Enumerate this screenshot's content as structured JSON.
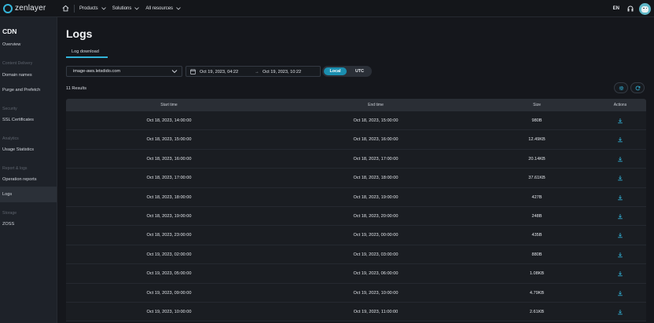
{
  "brand": {
    "name": "zenlayer",
    "accent": "#32b3d9"
  },
  "topnav": {
    "items": [
      {
        "label": "Products"
      },
      {
        "label": "Solutions"
      },
      {
        "label": "All resources"
      }
    ],
    "language": "EN"
  },
  "sidebar": {
    "title": "CDN",
    "overview": "Overview",
    "group_content_delivery": "Content Delivery",
    "domain_names": "Domain names",
    "purge_prefetch": "Purge and Prefetch",
    "group_security": "Security",
    "ssl_certificates": "SSL Certificates",
    "group_analytics": "Analytics",
    "usage_statistics": "Usage Statistics",
    "group_report_logs": "Report & logs",
    "operation_reports": "Operation reports",
    "logs": "Logs",
    "group_storage": "Storage",
    "zoss": "ZOSS"
  },
  "page": {
    "title": "Logs",
    "tab_label": "Log download"
  },
  "filters": {
    "domain": "image-aws.letsdido.com",
    "start_date": "Oct 19, 2023, 04:22",
    "end_date": "Oct 19, 2023, 10:22",
    "arrow": "→",
    "tz_local": "Local",
    "tz_utc": "UTC"
  },
  "results_label": "11 Results",
  "table": {
    "headers": {
      "start": "Start time",
      "end": "End time",
      "size": "Size",
      "actions": "Actions"
    },
    "rows": [
      {
        "start": "Oct 18, 2023, 14:00:00",
        "end": "Oct 18, 2023, 15:00:00",
        "size": "980B"
      },
      {
        "start": "Oct 18, 2023, 15:00:00",
        "end": "Oct 18, 2023, 16:00:00",
        "size": "12.49KB"
      },
      {
        "start": "Oct 18, 2023, 16:00:00",
        "end": "Oct 18, 2023, 17:00:00",
        "size": "20.14KB"
      },
      {
        "start": "Oct 18, 2023, 17:00:00",
        "end": "Oct 18, 2023, 18:00:00",
        "size": "37.61KB"
      },
      {
        "start": "Oct 18, 2023, 18:00:00",
        "end": "Oct 18, 2023, 19:00:00",
        "size": "427B"
      },
      {
        "start": "Oct 18, 2023, 19:00:00",
        "end": "Oct 18, 2023, 20:00:00",
        "size": "248B"
      },
      {
        "start": "Oct 18, 2023, 23:00:00",
        "end": "Oct 19, 2023, 00:00:00",
        "size": "435B"
      },
      {
        "start": "Oct 19, 2023, 02:00:00",
        "end": "Oct 19, 2023, 03:00:00",
        "size": "880B"
      },
      {
        "start": "Oct 19, 2023, 05:00:00",
        "end": "Oct 19, 2023, 06:00:00",
        "size": "1.08KB"
      },
      {
        "start": "Oct 19, 2023, 09:00:00",
        "end": "Oct 19, 2023, 10:00:00",
        "size": "4.79KB"
      },
      {
        "start": "Oct 19, 2023, 10:00:00",
        "end": "Oct 19, 2023, 11:00:00",
        "size": "2.61KB"
      }
    ]
  }
}
